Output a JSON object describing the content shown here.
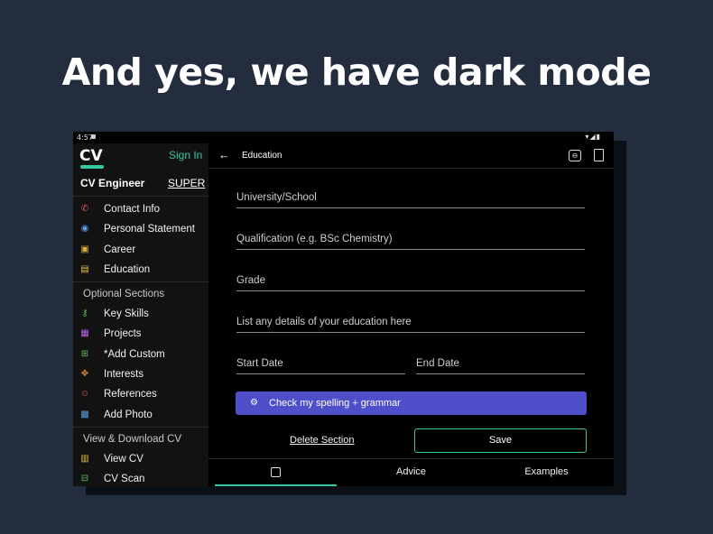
{
  "headline": "And yes, we have dark mode",
  "status_bar": {
    "time": "4:57",
    "icons": "▾◢▮"
  },
  "sidebar": {
    "logo": "CV",
    "sign_in": "Sign In",
    "app_name": "CV Engineer",
    "badge": "SUPER",
    "main_items": [
      {
        "label": "Contact Info",
        "icon": "phone-icon",
        "color": "#e05a5a"
      },
      {
        "label": "Personal Statement",
        "icon": "person-icon",
        "color": "#5aa0e0"
      },
      {
        "label": "Career",
        "icon": "briefcase-icon",
        "color": "#e0b040"
      },
      {
        "label": "Education",
        "icon": "book-icon",
        "color": "#e0c040"
      }
    ],
    "optional_label": "Optional Sections",
    "optional_items": [
      {
        "label": "Key Skills",
        "icon": "key-icon",
        "color": "#5ac05a"
      },
      {
        "label": "Projects",
        "icon": "clipboard-icon",
        "color": "#c060e0"
      },
      {
        "label": "*Add Custom",
        "icon": "plus-icon",
        "color": "#5ac05a"
      },
      {
        "label": "Interests",
        "icon": "interests-icon",
        "color": "#e08a40"
      },
      {
        "label": "References",
        "icon": "people-icon",
        "color": "#e05a5a"
      },
      {
        "label": "Add Photo",
        "icon": "photo-icon",
        "color": "#5aa0e0"
      }
    ],
    "view_label": "View & Download CV",
    "view_items": [
      {
        "label": "View CV",
        "icon": "document-icon",
        "color": "#e0c040"
      },
      {
        "label": "CV Scan",
        "icon": "scan-icon",
        "color": "#5ac05a"
      }
    ]
  },
  "main": {
    "title": "Education",
    "fields": {
      "school": "University/School",
      "qualification": "Qualification (e.g. BSc Chemistry)",
      "grade": "Grade",
      "details": "List any details of your education here",
      "start_date": "Start Date",
      "end_date": "End Date"
    },
    "spell_button": "Check my spelling + grammar",
    "delete_link": "Delete Section",
    "save_button": "Save",
    "tabs": {
      "advice": "Advice",
      "examples": "Examples"
    }
  },
  "colors": {
    "accent": "#35c7a0",
    "spell_button": "#4f4fc9",
    "background": "#232d3d"
  }
}
